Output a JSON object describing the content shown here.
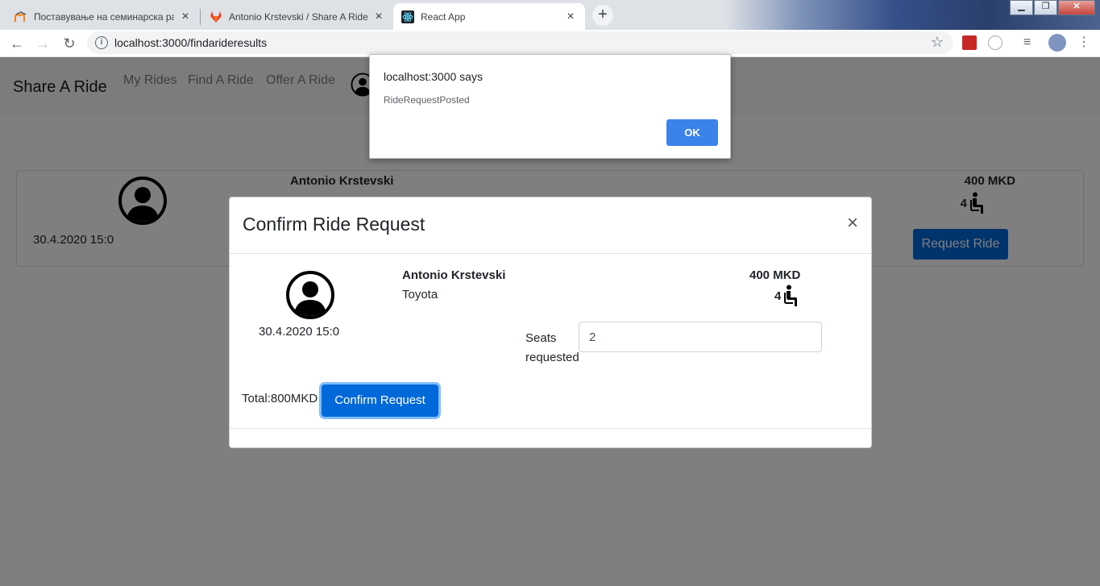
{
  "browser": {
    "tabs": [
      {
        "title": "Поставување на семинарска ра",
        "favicon": "moodle-icon"
      },
      {
        "title": "Antonio Krstevski / Share A Ride",
        "favicon": "gitlab-icon"
      },
      {
        "title": "React App",
        "favicon": "react-icon",
        "active": true
      }
    ],
    "new_tab": "+",
    "url": "localhost:3000/findarideresults"
  },
  "navbar": {
    "brand": "Share A Ride",
    "links": [
      "My Rides",
      "Find A Ride",
      "Offer A Ride"
    ]
  },
  "ride_card": {
    "date": "30.4.2020 15:0",
    "name": "Antonio Krstevski",
    "price": "400 MKD",
    "seats": "4",
    "request_button": "Request Ride"
  },
  "modal": {
    "title": "Confirm Ride Request",
    "close": "×",
    "date": "30.4.2020 15:0",
    "name": "Antonio Krstevski",
    "car": "Toyota",
    "price": "400 MKD",
    "seats": "4",
    "seats_label": "Seats requested",
    "seats_value": "2",
    "total": "Total:800MKD",
    "confirm_button": "Confirm Request"
  },
  "alert": {
    "origin": "localhost:3000 says",
    "message": "RideRequestPosted",
    "ok_label": "OK"
  },
  "colors": {
    "primary": "#0069d9",
    "alert_ok": "#3b83eb"
  }
}
